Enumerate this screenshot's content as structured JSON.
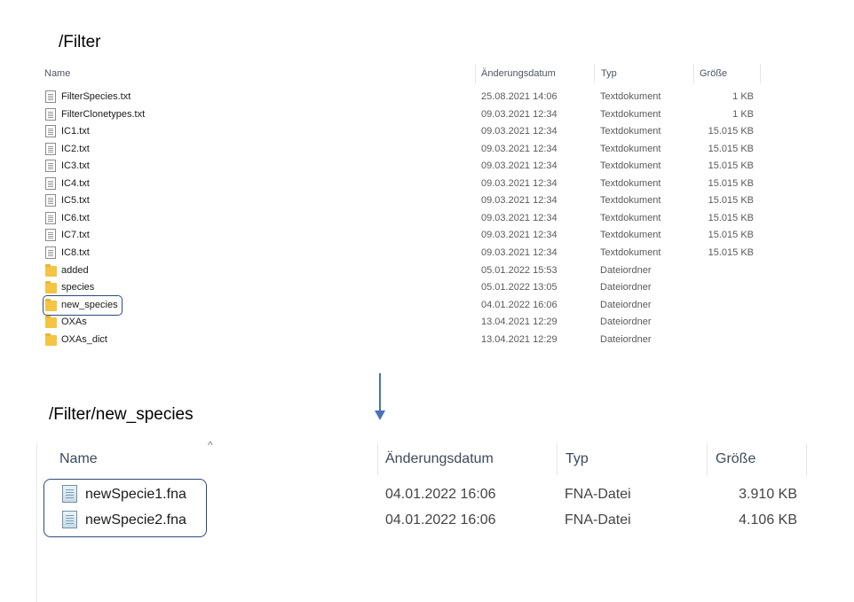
{
  "top": {
    "path": "/Filter",
    "headers": {
      "name": "Name",
      "date": "Änderungsdatum",
      "type": "Typ",
      "size": "Größe"
    },
    "rows": [
      {
        "name": "FilterSpecies.txt",
        "date": "25.08.2021 14:06",
        "type": "Textdokument",
        "size": "1 KB",
        "icon": "text-file-icon"
      },
      {
        "name": "FilterClonetypes.txt",
        "date": "09.03.2021 12:34",
        "type": "Textdokument",
        "size": "1 KB",
        "icon": "text-file-icon"
      },
      {
        "name": "IC1.txt",
        "date": "09.03.2021 12:34",
        "type": "Textdokument",
        "size": "15.015 KB",
        "icon": "text-file-icon"
      },
      {
        "name": "IC2.txt",
        "date": "09.03.2021 12:34",
        "type": "Textdokument",
        "size": "15.015 KB",
        "icon": "text-file-icon"
      },
      {
        "name": "IC3.txt",
        "date": "09.03.2021 12:34",
        "type": "Textdokument",
        "size": "15.015 KB",
        "icon": "text-file-icon"
      },
      {
        "name": "IC4.txt",
        "date": "09.03.2021 12:34",
        "type": "Textdokument",
        "size": "15.015 KB",
        "icon": "text-file-icon"
      },
      {
        "name": "IC5.txt",
        "date": "09.03.2021 12:34",
        "type": "Textdokument",
        "size": "15.015 KB",
        "icon": "text-file-icon"
      },
      {
        "name": "IC6.txt",
        "date": "09.03.2021 12:34",
        "type": "Textdokument",
        "size": "15.015 KB",
        "icon": "text-file-icon"
      },
      {
        "name": "IC7.txt",
        "date": "09.03.2021 12:34",
        "type": "Textdokument",
        "size": "15.015 KB",
        "icon": "text-file-icon"
      },
      {
        "name": "IC8.txt",
        "date": "09.03.2021 12:34",
        "type": "Textdokument",
        "size": "15.015 KB",
        "icon": "text-file-icon"
      },
      {
        "name": "added",
        "date": "05.01.2022 15:53",
        "type": "Dateiordner",
        "size": "",
        "icon": "folder-icon"
      },
      {
        "name": "species",
        "date": "05.01.2022 13:05",
        "type": "Dateiordner",
        "size": "",
        "icon": "folder-icon"
      },
      {
        "name": "new_species",
        "date": "04.01.2022 16:06",
        "type": "Dateiordner",
        "size": "",
        "icon": "folder-icon"
      },
      {
        "name": "OXAs",
        "date": "13.04.2021 12:29",
        "type": "Dateiordner",
        "size": "",
        "icon": "folder-icon"
      },
      {
        "name": "OXAs_dict",
        "date": "13.04.2021 12:29",
        "type": "Dateiordner",
        "size": "",
        "icon": "folder-icon"
      }
    ]
  },
  "bottom": {
    "path": "/Filter/new_species",
    "sort_indicator": "^",
    "headers": {
      "name": "Name",
      "date": "Änderungsdatum",
      "type": "Typ",
      "size": "Größe"
    },
    "rows": [
      {
        "name": "newSpecie1.fna",
        "date": "04.01.2022 16:06",
        "type": "FNA-Datei",
        "size": "3.910 KB",
        "icon": "fna-file-icon"
      },
      {
        "name": "newSpecie2.fna",
        "date": "04.01.2022 16:06",
        "type": "FNA-Datei",
        "size": "4.106 KB",
        "icon": "fna-file-icon"
      }
    ]
  },
  "colors": {
    "highlight_border": "#2f4a7a",
    "arrow": "#4a72b8",
    "folder": "#f4c542"
  }
}
